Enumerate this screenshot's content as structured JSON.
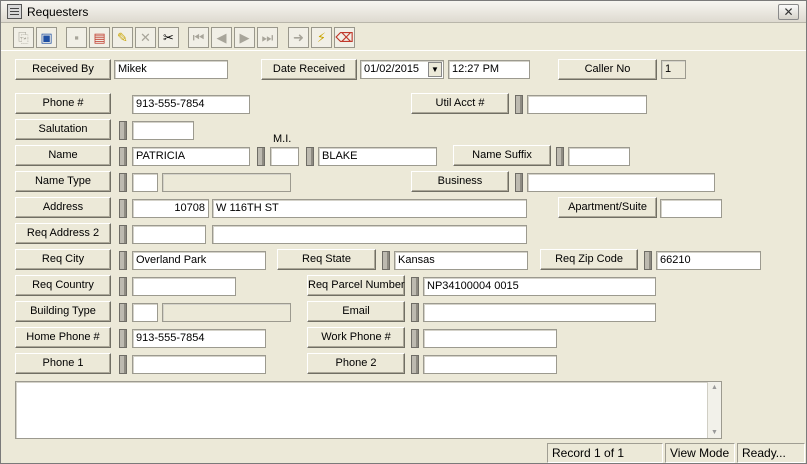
{
  "window": {
    "title": "Requesters",
    "close_symbol": "✕"
  },
  "toolbar": {
    "buttons": [
      {
        "icon": "copy-icon",
        "glyph": "⎘",
        "enabled": false
      },
      {
        "icon": "open-record-icon",
        "glyph": "▣",
        "enabled": true
      },
      {
        "icon": "save-icon",
        "glyph": "▪",
        "enabled": false
      },
      {
        "icon": "books-icon",
        "glyph": "▤",
        "enabled": true
      },
      {
        "icon": "pencil-edit-icon",
        "glyph": "✎",
        "enabled": true
      },
      {
        "icon": "delete-x-icon",
        "glyph": "✕",
        "enabled": false
      },
      {
        "icon": "scissors-icon",
        "glyph": "✂",
        "enabled": true
      },
      {
        "icon": "first-record-icon",
        "glyph": "⏮",
        "enabled": false
      },
      {
        "icon": "previous-record-icon",
        "glyph": "◀",
        "enabled": false
      },
      {
        "icon": "next-record-icon",
        "glyph": "▶",
        "enabled": false
      },
      {
        "icon": "last-record-icon",
        "glyph": "⏭",
        "enabled": false
      },
      {
        "icon": "go-arrow-icon",
        "glyph": "➜",
        "enabled": false
      },
      {
        "icon": "lightning-icon",
        "glyph": "⚡",
        "enabled": true
      },
      {
        "icon": "eraser-icon",
        "glyph": "⌫",
        "enabled": true
      }
    ]
  },
  "header": {
    "received_by_label": "Received By",
    "received_by_value": "Mikek",
    "date_received_label": "Date Received",
    "date_value": "01/02/2015",
    "time_value": "12:27 PM",
    "caller_no_label": "Caller No",
    "caller_no_value": "1"
  },
  "form": {
    "phone_label": "Phone #",
    "phone_value": "913-555-7854",
    "util_acct_label": "Util Acct #",
    "util_acct_value": "",
    "salutation_label": "Salutation",
    "salutation_value": "",
    "mi_label": "M.I.",
    "name_label": "Name",
    "first_name": "PATRICIA",
    "middle_initial": "",
    "last_name": "BLAKE",
    "name_suffix_label": "Name Suffix",
    "name_suffix_value": "",
    "name_type_label": "Name Type",
    "name_type_code": "",
    "name_type_desc": "",
    "business_label": "Business",
    "business_value": "",
    "address_label": "Address",
    "address_number": "10708",
    "address_street": "W 116TH ST",
    "apt_label": "Apartment/Suite",
    "apt_value": "",
    "req_address2_label": "Req Address 2",
    "req_address2_a": "",
    "req_address2_b": "",
    "req_city_label": "Req City",
    "req_city_value": "Overland Park",
    "req_state_label": "Req State",
    "req_state_value": "Kansas",
    "req_zip_label": "Req Zip Code",
    "req_zip_value": "66210",
    "req_country_label": "Req Country",
    "req_country_value": "",
    "req_parcel_label": "Req Parcel Number",
    "req_parcel_value": "NP34100004 0015",
    "building_type_label": "Building Type",
    "building_type_code": "",
    "building_type_desc": "",
    "email_label": "Email",
    "email_value": "",
    "home_phone_label": "Home Phone #",
    "home_phone_value": "913-555-7854",
    "work_phone_label": "Work Phone #",
    "work_phone_value": "",
    "phone1_label": "Phone 1",
    "phone1_value": "",
    "phone2_label": "Phone 2",
    "phone2_value": "",
    "notes_value": ""
  },
  "status": {
    "record": "Record 1 of 1",
    "mode": "View Mode",
    "state": "Ready..."
  }
}
